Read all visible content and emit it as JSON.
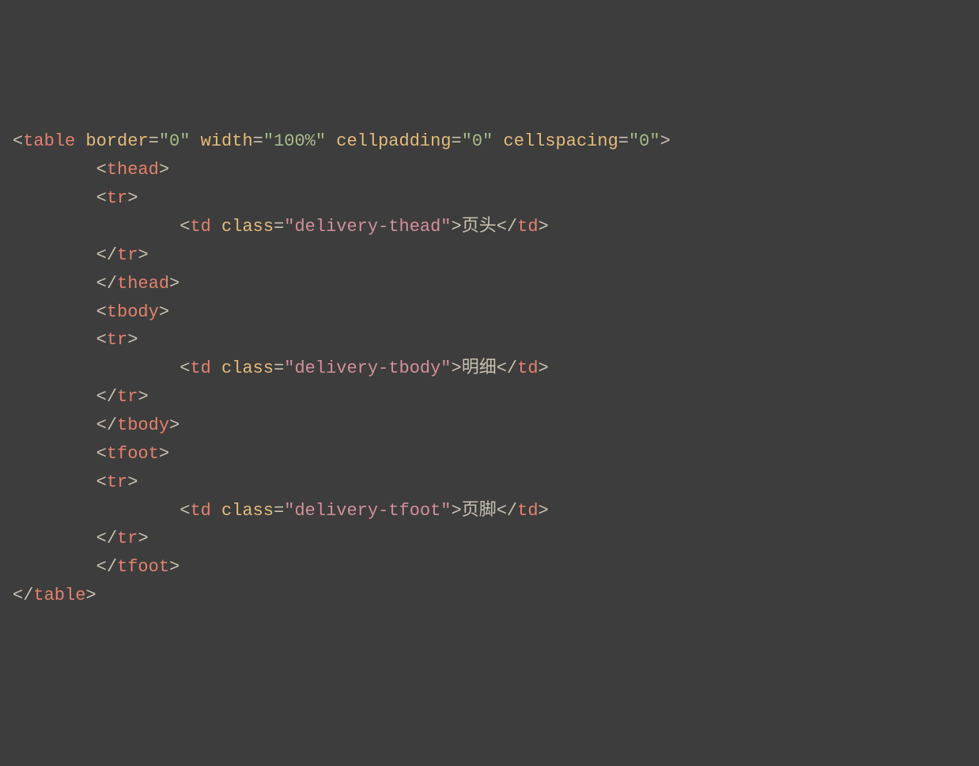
{
  "code": {
    "lines": [
      {
        "indent": 0,
        "segments": [
          {
            "type": "punct",
            "text": "<"
          },
          {
            "type": "tag",
            "text": "table"
          },
          {
            "type": "punct",
            "text": " "
          },
          {
            "type": "attr-name",
            "text": "border"
          },
          {
            "type": "punct",
            "text": "="
          },
          {
            "type": "attr-value",
            "text": "\"0\""
          },
          {
            "type": "punct",
            "text": " "
          },
          {
            "type": "attr-name",
            "text": "width"
          },
          {
            "type": "punct",
            "text": "="
          },
          {
            "type": "attr-value",
            "text": "\"100%\""
          },
          {
            "type": "punct",
            "text": " "
          },
          {
            "type": "attr-name",
            "text": "cellpadding"
          },
          {
            "type": "punct",
            "text": "="
          },
          {
            "type": "attr-value",
            "text": "\"0\""
          },
          {
            "type": "punct",
            "text": " "
          },
          {
            "type": "attr-name",
            "text": "cellspacing"
          },
          {
            "type": "punct",
            "text": "="
          },
          {
            "type": "attr-value",
            "text": "\"0\""
          },
          {
            "type": "punct",
            "text": ">"
          }
        ]
      },
      {
        "indent": 1,
        "segments": [
          {
            "type": "punct",
            "text": "<"
          },
          {
            "type": "tag",
            "text": "thead"
          },
          {
            "type": "punct",
            "text": ">"
          }
        ]
      },
      {
        "indent": 1,
        "segments": [
          {
            "type": "punct",
            "text": "<"
          },
          {
            "type": "tag",
            "text": "tr"
          },
          {
            "type": "punct",
            "text": ">"
          }
        ]
      },
      {
        "indent": 2,
        "segments": [
          {
            "type": "punct",
            "text": "<"
          },
          {
            "type": "tag",
            "text": "td"
          },
          {
            "type": "punct",
            "text": " "
          },
          {
            "type": "attr-name",
            "text": "class"
          },
          {
            "type": "punct",
            "text": "="
          },
          {
            "type": "class-value",
            "text": "\"delivery-thead\""
          },
          {
            "type": "punct",
            "text": ">"
          },
          {
            "type": "text-content",
            "text": "页头"
          },
          {
            "type": "punct",
            "text": "</"
          },
          {
            "type": "tag",
            "text": "td"
          },
          {
            "type": "punct",
            "text": ">"
          }
        ]
      },
      {
        "indent": 1,
        "segments": [
          {
            "type": "punct",
            "text": "</"
          },
          {
            "type": "tag",
            "text": "tr"
          },
          {
            "type": "punct",
            "text": ">"
          }
        ]
      },
      {
        "indent": 1,
        "segments": [
          {
            "type": "punct",
            "text": "</"
          },
          {
            "type": "tag",
            "text": "thead"
          },
          {
            "type": "punct",
            "text": ">"
          }
        ]
      },
      {
        "indent": 1,
        "segments": [
          {
            "type": "punct",
            "text": "<"
          },
          {
            "type": "tag",
            "text": "tbody"
          },
          {
            "type": "punct",
            "text": ">"
          }
        ]
      },
      {
        "indent": 1,
        "segments": [
          {
            "type": "punct",
            "text": "<"
          },
          {
            "type": "tag",
            "text": "tr"
          },
          {
            "type": "punct",
            "text": ">"
          }
        ]
      },
      {
        "indent": 2,
        "segments": [
          {
            "type": "punct",
            "text": "<"
          },
          {
            "type": "tag",
            "text": "td"
          },
          {
            "type": "punct",
            "text": " "
          },
          {
            "type": "attr-name",
            "text": "class"
          },
          {
            "type": "punct",
            "text": "="
          },
          {
            "type": "class-value",
            "text": "\"delivery-tbody\""
          },
          {
            "type": "punct",
            "text": ">"
          },
          {
            "type": "text-content",
            "text": "明细"
          },
          {
            "type": "punct",
            "text": "</"
          },
          {
            "type": "tag",
            "text": "td"
          },
          {
            "type": "punct",
            "text": ">"
          }
        ]
      },
      {
        "indent": 1,
        "segments": [
          {
            "type": "punct",
            "text": "</"
          },
          {
            "type": "tag",
            "text": "tr"
          },
          {
            "type": "punct",
            "text": ">"
          }
        ]
      },
      {
        "indent": 1,
        "segments": [
          {
            "type": "punct",
            "text": "</"
          },
          {
            "type": "tag",
            "text": "tbody"
          },
          {
            "type": "punct",
            "text": ">"
          }
        ]
      },
      {
        "indent": 1,
        "segments": [
          {
            "type": "punct",
            "text": "<"
          },
          {
            "type": "tag",
            "text": "tfoot"
          },
          {
            "type": "punct",
            "text": ">"
          }
        ]
      },
      {
        "indent": 1,
        "segments": [
          {
            "type": "punct",
            "text": "<"
          },
          {
            "type": "tag",
            "text": "tr"
          },
          {
            "type": "punct",
            "text": ">"
          }
        ]
      },
      {
        "indent": 2,
        "segments": [
          {
            "type": "punct",
            "text": "<"
          },
          {
            "type": "tag",
            "text": "td"
          },
          {
            "type": "punct",
            "text": " "
          },
          {
            "type": "attr-name",
            "text": "class"
          },
          {
            "type": "punct",
            "text": "="
          },
          {
            "type": "class-value",
            "text": "\"delivery-tfoot\""
          },
          {
            "type": "punct",
            "text": ">"
          },
          {
            "type": "text-content",
            "text": "页脚"
          },
          {
            "type": "punct",
            "text": "</"
          },
          {
            "type": "tag",
            "text": "td"
          },
          {
            "type": "punct",
            "text": ">"
          }
        ]
      },
      {
        "indent": 1,
        "segments": [
          {
            "type": "punct",
            "text": "</"
          },
          {
            "type": "tag",
            "text": "tr"
          },
          {
            "type": "punct",
            "text": ">"
          }
        ]
      },
      {
        "indent": 1,
        "segments": [
          {
            "type": "punct",
            "text": "</"
          },
          {
            "type": "tag",
            "text": "tfoot"
          },
          {
            "type": "punct",
            "text": ">"
          }
        ]
      },
      {
        "indent": 0,
        "segments": [
          {
            "type": "punct",
            "text": "</"
          },
          {
            "type": "tag",
            "text": "table"
          },
          {
            "type": "punct",
            "text": ">"
          }
        ]
      }
    ]
  }
}
